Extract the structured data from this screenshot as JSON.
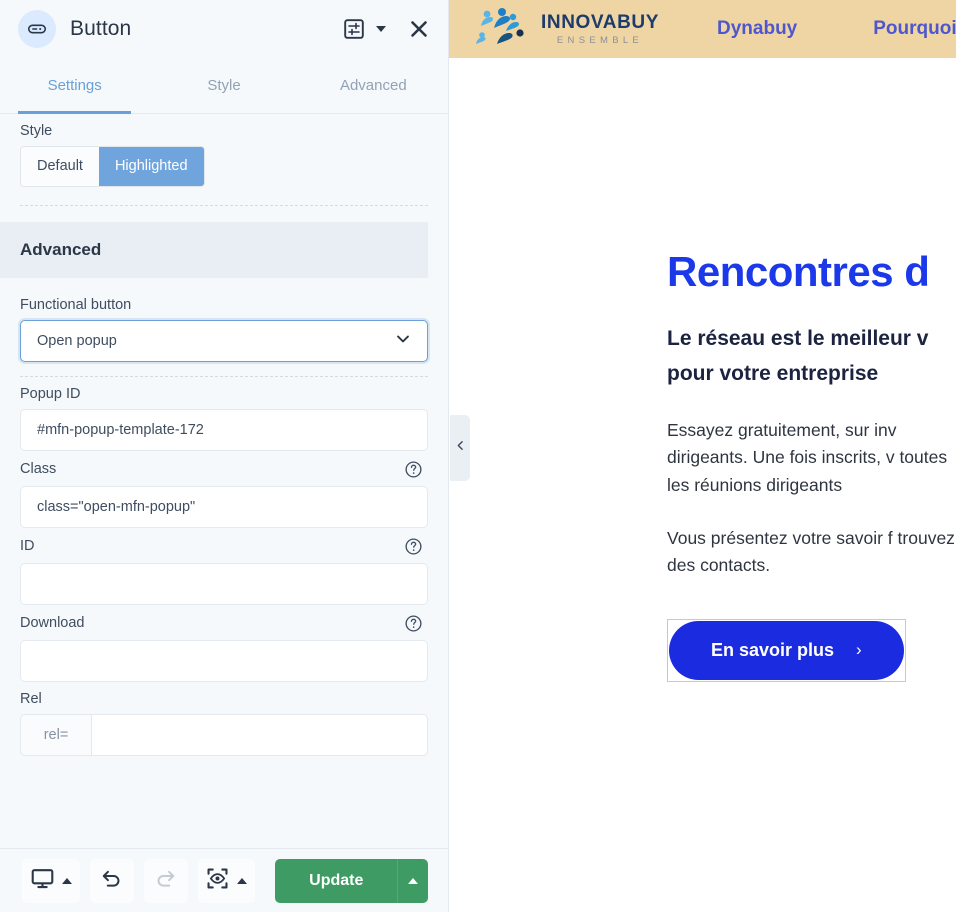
{
  "editor": {
    "header": {
      "widget_icon": "button-widget-icon",
      "title": "Button",
      "settings_icon": "sliders-icon",
      "settings_caret_icon": "caret-down-icon",
      "close_icon": "close-icon"
    },
    "tabs": [
      {
        "label": "Settings",
        "active": true
      },
      {
        "label": "Style",
        "active": false
      },
      {
        "label": "Advanced",
        "active": false
      }
    ],
    "style_section": {
      "label": "Style",
      "options": [
        {
          "label": "Default",
          "active": false
        },
        {
          "label": "Highlighted",
          "active": true
        }
      ]
    },
    "advanced_section": {
      "heading": "Advanced",
      "fields": [
        {
          "label": "Functional button",
          "type": "select",
          "value": "Open popup",
          "focused": true,
          "help": false,
          "chevron_icon": "chevron-down-icon"
        },
        {
          "label": "Popup ID",
          "type": "text",
          "value": "#mfn-popup-template-172",
          "placeholder": "",
          "help": false
        },
        {
          "label": "Class",
          "type": "text",
          "value": "class=\"open-mfn-popup\"",
          "placeholder": "",
          "help": true
        },
        {
          "label": "ID",
          "type": "text",
          "value": "",
          "placeholder": "",
          "help": true
        },
        {
          "label": "Download",
          "type": "text",
          "value": "",
          "placeholder": "",
          "help": true
        },
        {
          "label": "Rel",
          "type": "addon-text",
          "addon": "rel=",
          "value": "",
          "placeholder": "",
          "help": false
        }
      ]
    },
    "footer": {
      "responsive_icon": "desktop-icon",
      "responsive_caret_icon": "caret-up-icon",
      "undo_icon": "undo-icon",
      "redo_icon": "redo-icon",
      "preview_icon": "preview-eye-icon",
      "preview_caret_icon": "caret-up-icon",
      "update_label": "Update",
      "update_caret_icon": "caret-up-icon",
      "update_color": "#3d9b63"
    }
  },
  "preview": {
    "collapse_handle_icon": "chevron-left-icon",
    "site_header": {
      "background_color": "#f0d5a4",
      "logo": {
        "icon": "innovabuy-people-logo-icon",
        "name": "INNOVABUY",
        "tagline": "ENSEMBLE"
      },
      "nav": [
        {
          "label": "Dynabuy"
        },
        {
          "label": "Pourquoi"
        }
      ],
      "nav_color": "#4e57cd"
    },
    "hero": {
      "title": "Rencontres d",
      "title_color": "#1b39e8",
      "subtitle": "Le réseau est le meilleur v\npour votre entreprise",
      "paragraph_1": "Essayez gratuitement, sur inv dirigeants. Une fois inscrits, v toutes les réunions dirigeants",
      "paragraph_2": "Vous présentez votre savoir f trouvez des contacts.",
      "cta_label": "En savoir plus",
      "cta_chevron": "›",
      "cta_color": "#1b2ce0",
      "cta_selected": true
    }
  }
}
